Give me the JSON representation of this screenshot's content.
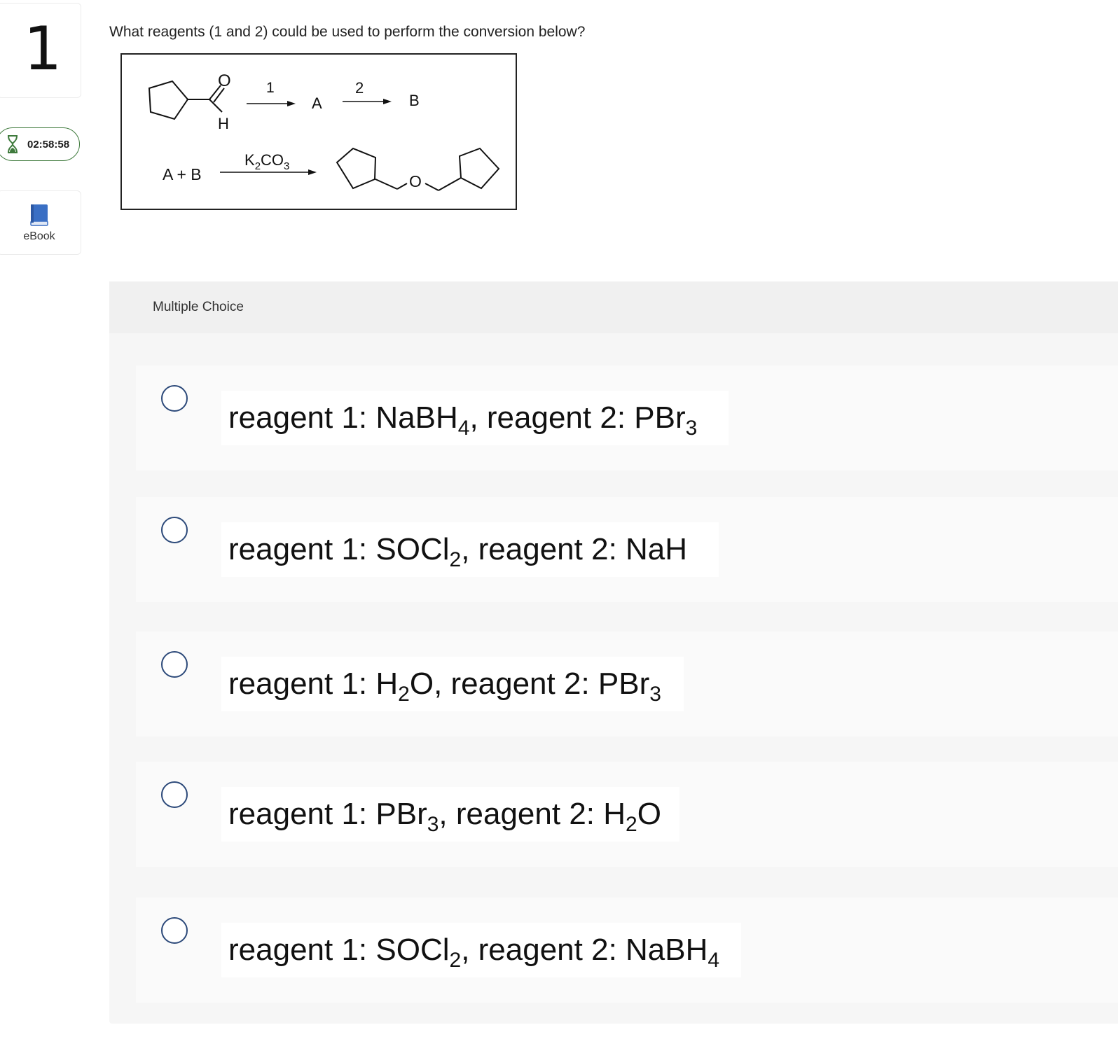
{
  "question_number": "1",
  "timer": {
    "value": "02:58:58",
    "icon": "hourglass-icon"
  },
  "ebook": {
    "label": "eBook",
    "icon": "book-icon"
  },
  "question": {
    "text": "What reagents (1 and 2) could be used to perform the conversion below?"
  },
  "figure": {
    "aldehyde_O": "O",
    "aldehyde_H": "H",
    "step1": "1",
    "intermediate_A": "A",
    "step2": "2",
    "intermediate_B": "B",
    "reactants": "A + B",
    "reagent_K": "K",
    "reagent_sub2": "2",
    "reagent_CO": "CO",
    "reagent_sub3": "3",
    "ether_O": "O"
  },
  "multiple_choice": {
    "label": "Multiple Choice",
    "choices": [
      {
        "parts": [
          "reagent 1: NaBH",
          "4",
          ", reagent 2: PBr",
          "3",
          ""
        ]
      },
      {
        "parts": [
          "reagent 1: SOCl",
          "2",
          ", reagent 2: NaH",
          "",
          ""
        ]
      },
      {
        "parts": [
          "reagent 1: H",
          "2",
          "O, reagent 2: PBr",
          "3",
          ""
        ]
      },
      {
        "parts": [
          "reagent 1: PBr",
          "3",
          ", reagent 2: H",
          "2",
          "O"
        ]
      },
      {
        "parts": [
          "reagent 1: SOCl",
          "2",
          ", reagent 2: NaBH",
          "4",
          ""
        ]
      }
    ]
  }
}
